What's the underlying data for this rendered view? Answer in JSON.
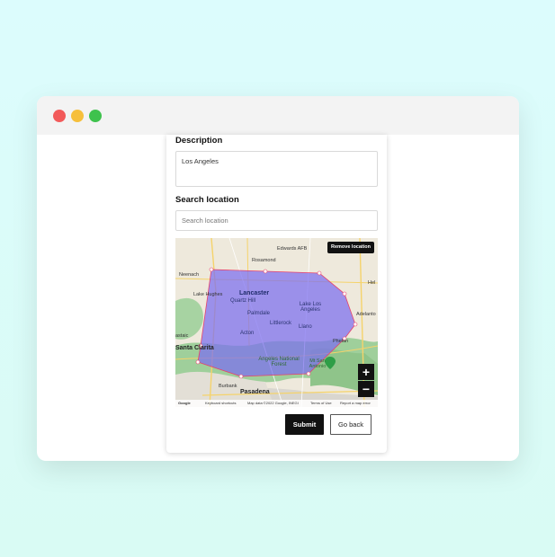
{
  "window": {
    "controls": [
      "close",
      "minimize",
      "maximize"
    ]
  },
  "form": {
    "description_label": "Description",
    "description_value": "Los Angeles",
    "search_label": "Search location",
    "search_placeholder": "Search location",
    "search_value": ""
  },
  "map": {
    "remove_label": "Remove location",
    "zoom_in": "+",
    "zoom_out": "−",
    "places": {
      "edwards": "Edwards AFB",
      "rosamond": "Rosamond",
      "neenach": "Neenach",
      "lancaster": "Lancaster",
      "lake_hughes": "Lake Hughes",
      "quartz_hill": "Quartz Hill",
      "helendale": "Hel",
      "palmdale": "Palmdale",
      "lake_los_angeles": "Lake Los Angeles",
      "adelanto": "Adelanto",
      "littlerock": "Littlerock",
      "llano": "Llano",
      "acton": "Acton",
      "santa_clarita": "Santa Clarita",
      "castaic": "astaic",
      "phelan": "Phelan",
      "angeles_nf": "Angeles National Forest",
      "mt_baldy": "Mt San Antonio",
      "burbank": "Burbank",
      "pasadena": "Pasadena"
    },
    "attribution": {
      "logo": "Google",
      "shortcuts": "Keyboard shortcuts",
      "data": "Map data ©2022 Google, INEGI",
      "terms": "Terms of Use",
      "report": "Report a map error"
    },
    "colors": {
      "polygon_fill": "#7b6df0",
      "polygon_stroke": "#e8416a",
      "forest": "#9ccf9a",
      "desert": "#efe8d8"
    }
  },
  "actions": {
    "submit_label": "Submit",
    "back_label": "Go back"
  }
}
